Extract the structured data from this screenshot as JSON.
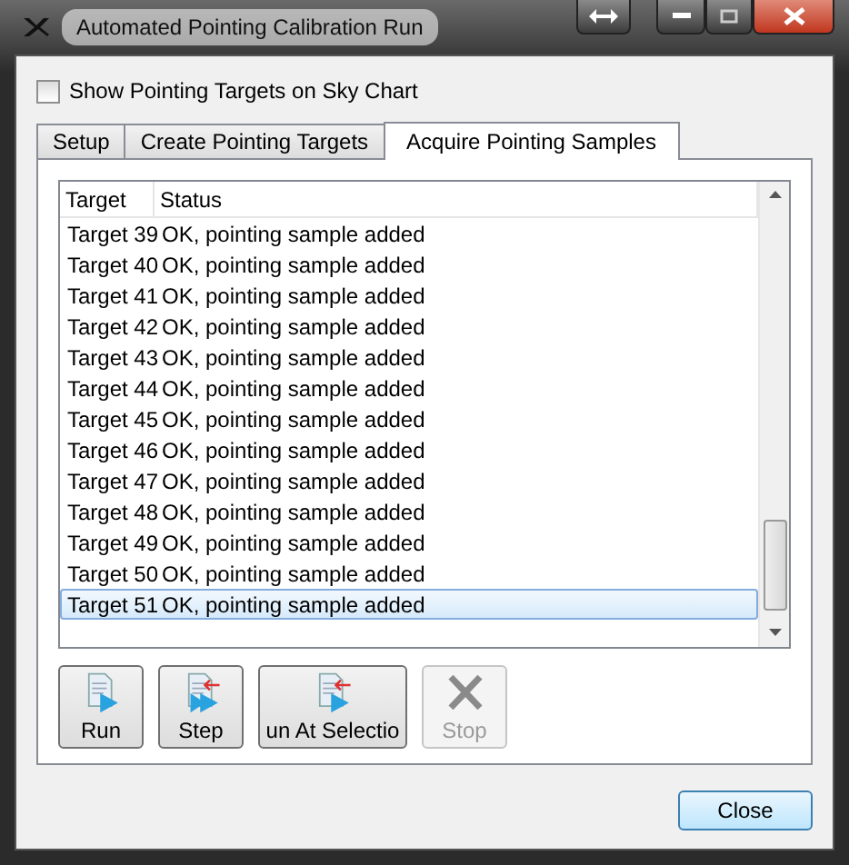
{
  "window": {
    "title": "Automated Pointing Calibration Run"
  },
  "show_targets": {
    "label": "Show Pointing Targets on Sky Chart",
    "checked": false
  },
  "tabs": [
    {
      "label": "Setup",
      "selected": false
    },
    {
      "label": "Create Pointing Targets",
      "selected": false
    },
    {
      "label": "Acquire Pointing Samples",
      "selected": true
    }
  ],
  "table": {
    "columns": [
      "Target",
      "Status"
    ],
    "rows": [
      {
        "target": "Target 39",
        "status": "OK, pointing sample added",
        "selected": false
      },
      {
        "target": "Target 40",
        "status": "OK, pointing sample added",
        "selected": false
      },
      {
        "target": "Target 41",
        "status": "OK, pointing sample added",
        "selected": false
      },
      {
        "target": "Target 42",
        "status": "OK, pointing sample added",
        "selected": false
      },
      {
        "target": "Target 43",
        "status": "OK, pointing sample added",
        "selected": false
      },
      {
        "target": "Target 44",
        "status": "OK, pointing sample added",
        "selected": false
      },
      {
        "target": "Target 45",
        "status": "OK, pointing sample added",
        "selected": false
      },
      {
        "target": "Target 46",
        "status": "OK, pointing sample added",
        "selected": false
      },
      {
        "target": "Target 47",
        "status": "OK, pointing sample added",
        "selected": false
      },
      {
        "target": "Target 48",
        "status": "OK, pointing sample added",
        "selected": false
      },
      {
        "target": "Target 49",
        "status": "OK, pointing sample added",
        "selected": false
      },
      {
        "target": "Target 50",
        "status": "OK, pointing sample added",
        "selected": false
      },
      {
        "target": "Target 51",
        "status": "OK, pointing sample added",
        "selected": true
      }
    ]
  },
  "actions": [
    {
      "kind": "run",
      "label": "Run",
      "disabled": false
    },
    {
      "kind": "step",
      "label": "Step",
      "disabled": false
    },
    {
      "kind": "run-selection",
      "label": "un At Selectio",
      "disabled": false
    },
    {
      "kind": "stop",
      "label": "Stop",
      "disabled": true
    }
  ],
  "close_button": "Close"
}
